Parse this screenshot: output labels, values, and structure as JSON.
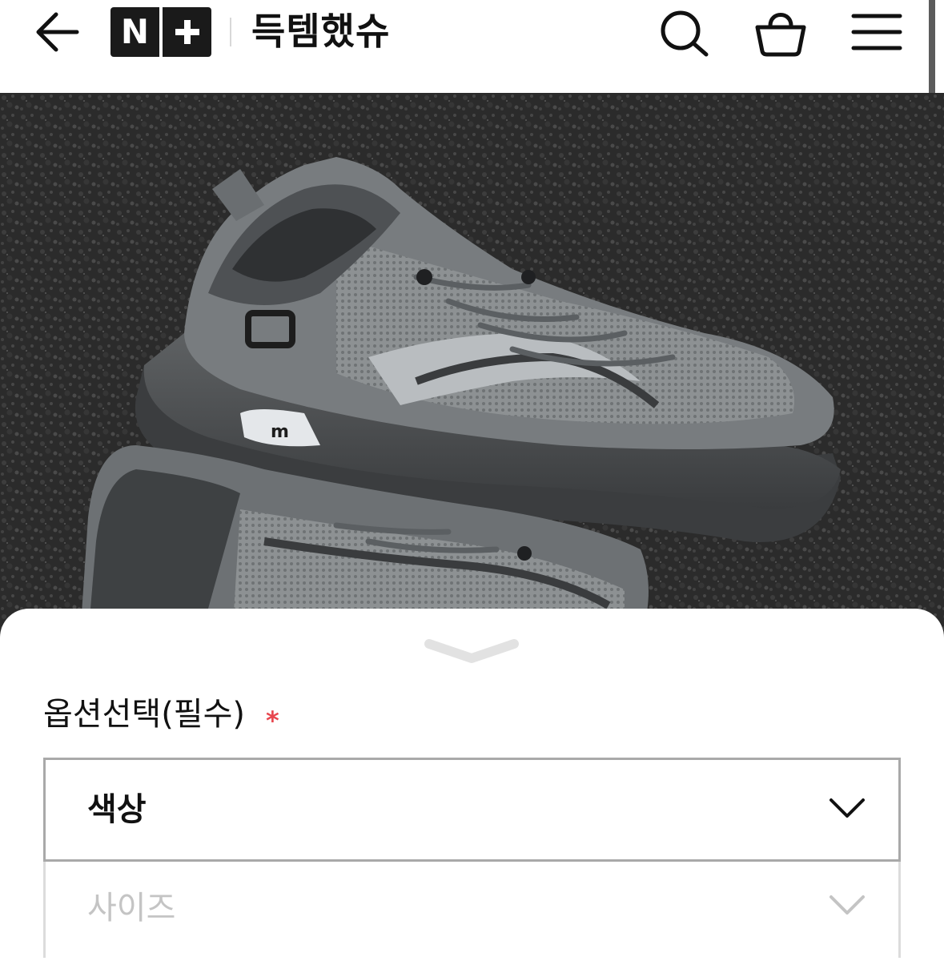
{
  "header": {
    "logo_text": "N+",
    "store_name": "득템했슈",
    "icons": [
      "back-arrow-icon",
      "search-icon",
      "shopping-bag-icon",
      "menu-icon"
    ]
  },
  "product": {
    "image_description_icon": "sneaker-photo"
  },
  "options_sheet": {
    "title": "옵션선택(필수)",
    "required_mark": "*",
    "selects": [
      {
        "label": "색상",
        "state": "active"
      },
      {
        "label": "사이즈",
        "state": "disabled"
      }
    ]
  },
  "colors": {
    "accent_required": "#e8474f",
    "logo_bg": "#1a1a1a",
    "text_primary": "#111111",
    "text_disabled": "#c4c4c4"
  }
}
